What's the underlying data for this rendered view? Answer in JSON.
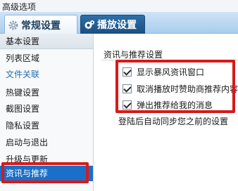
{
  "window": {
    "title": "高级选项"
  },
  "tabs": [
    {
      "label": "常规设置",
      "icon": "gear-icon",
      "active": true
    },
    {
      "label": "播放设置",
      "icon": "player-icon",
      "active": false
    }
  ],
  "sidebar": {
    "items": [
      {
        "label": "基本设置",
        "style": "header"
      },
      {
        "label": "列表区域",
        "style": "normal"
      },
      {
        "label": "文件关联",
        "style": "link"
      },
      {
        "label": "热键设置",
        "style": "normal"
      },
      {
        "label": "截图设置",
        "style": "normal"
      },
      {
        "label": "隐私设置",
        "style": "normal"
      },
      {
        "label": "启动与退出",
        "style": "normal"
      },
      {
        "label": "升级与更新",
        "style": "normal"
      },
      {
        "label": "资讯与推荐",
        "style": "selected"
      }
    ]
  },
  "content": {
    "section_title": "资讯与推荐设置",
    "options": [
      {
        "label": "显示暴风资讯窗口",
        "checked": true
      },
      {
        "label": "取消播放时赞助商推荐内容",
        "checked": true
      },
      {
        "label": "弹出推荐给我的消息",
        "checked": true
      }
    ],
    "footnote": "登陆后自动同步您之前的设置"
  },
  "colors": {
    "highlight": "#d61a1a",
    "selected": "#1b6fc9",
    "link": "#2a6cb0",
    "play_tab": "#1a4f80"
  }
}
